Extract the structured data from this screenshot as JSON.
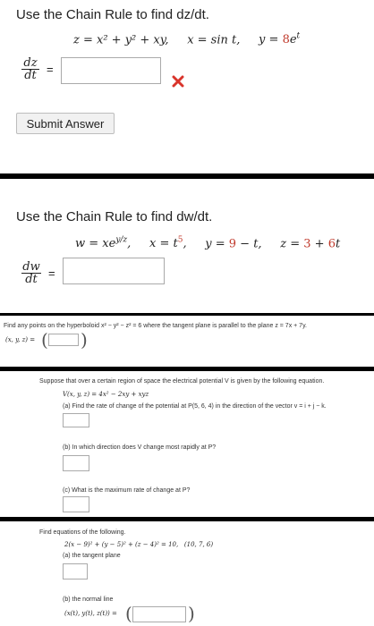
{
  "q1": {
    "title": "Use the Chain Rule to find dz/dt.",
    "eq_z": "z = x² + y² + xy,",
    "eq_x": "x = sin t,",
    "eq_y_prefix": "y = ",
    "eq_y_coef": "8",
    "eq_y_suffix": "e",
    "eq_y_exp": "t",
    "deriv_num": "dz",
    "deriv_den": "dt",
    "equals": "=",
    "answer_value": "",
    "status": "incorrect",
    "submit_label": "Submit Answer"
  },
  "q2": {
    "title": "Use the Chain Rule to find dw/dt.",
    "eq_w": "w = xe",
    "eq_w_exp": "y/z",
    "eq_w_end": ",",
    "eq_x_prefix": "x = t",
    "eq_x_exp": "5",
    "eq_x_end": ",",
    "eq_y_prefix": "y = ",
    "eq_y_coef": "9",
    "eq_y_suffix": " − t,",
    "eq_z_prefix": "z = ",
    "eq_z_coef": "3",
    "eq_z_mid": " + ",
    "eq_z_coef2": "6",
    "eq_z_suffix": "t",
    "deriv_num": "dw",
    "deriv_den": "dt",
    "equals": "=",
    "answer_value": ""
  },
  "q3": {
    "text": "Find any points on the hyperboloid x² − y² − z² = 6 where the tangent plane is parallel to the plane z = 7x + 7y.",
    "label": "(x, y, z) = ",
    "answer_value": ""
  },
  "q4": {
    "intro": "Suppose that over a certain region of space the electrical potential V is given by the following equation.",
    "equation": "V(x, y, z) = 4x² − 2xy + xyz",
    "part_a": "(a) Find the rate of change of the potential at P(5, 6, 4) in the direction of the vector v = i + j − k.",
    "part_b": "(b) In which direction does V change most rapidly at P?",
    "part_c": "(c) What is the maximum rate of change at P?",
    "answer_a": "",
    "answer_b": "",
    "answer_c": ""
  },
  "q5": {
    "intro": "Find equations of the following.",
    "equation": "2(x − 9)² + (y − 5)² + (z − 4)² = 10,",
    "point": "(10, 7, 6)",
    "part_a": "(a) the tangent plane",
    "part_b": "(b) the normal line",
    "label_b": "(x(t), y(t), z(t)) = ",
    "answer_a": "",
    "answer_b": ""
  },
  "colors": {
    "accent_red": "#c0392b",
    "separator": "#000000",
    "button_bg": "#f1f1f1"
  },
  "icons": {
    "status_icon": "x-mark-icon"
  }
}
